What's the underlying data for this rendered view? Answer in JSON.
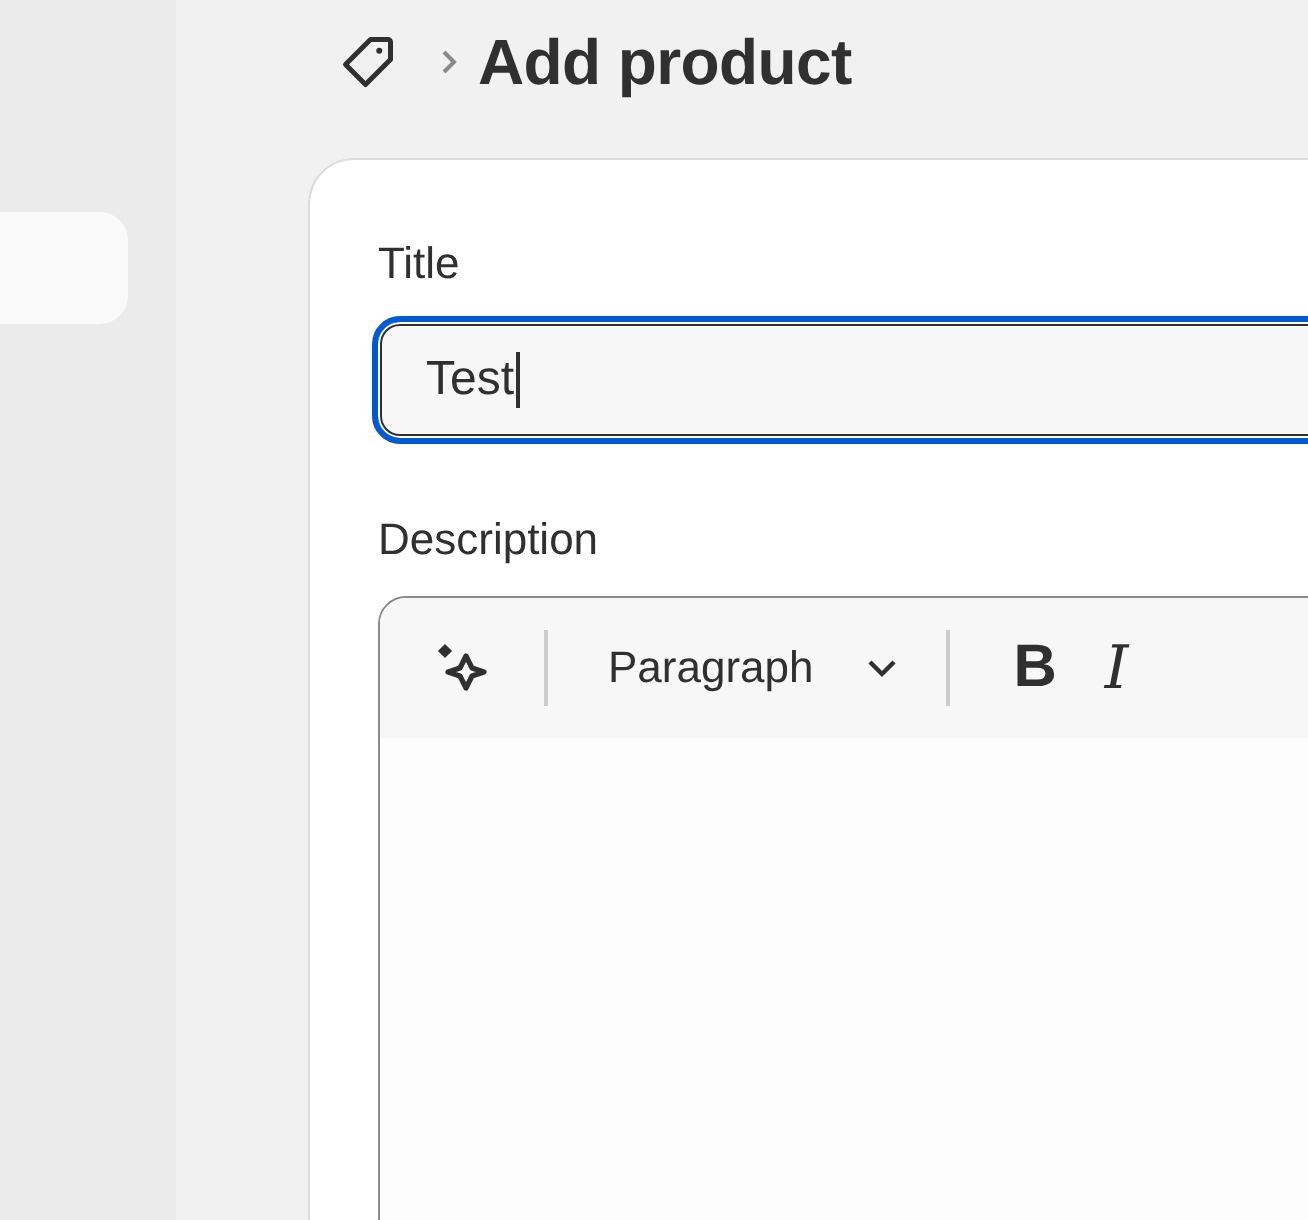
{
  "header": {
    "title": "Add product"
  },
  "title_field": {
    "label": "Title",
    "value": "Test",
    "focused": true
  },
  "description": {
    "label": "Description",
    "toolbar": {
      "block_format": "Paragraph",
      "buttons": [
        {
          "kind": "bold",
          "label": "B"
        },
        {
          "kind": "italic",
          "label": "I"
        }
      ]
    }
  }
}
